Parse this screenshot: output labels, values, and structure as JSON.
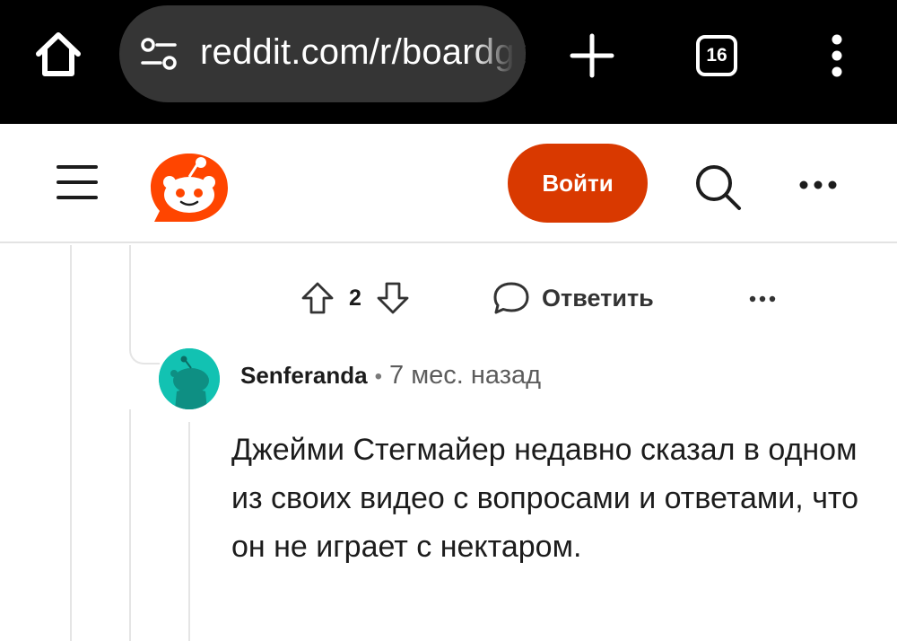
{
  "browser": {
    "url": "reddit.com/r/boardgames",
    "tab_count": "16",
    "icons": [
      "home-icon",
      "site-settings-icon",
      "plus-icon",
      "tabs-icon",
      "kebab-menu-icon"
    ],
    "colors": {
      "bar": "#000000",
      "urlbar": "#353535"
    }
  },
  "header": {
    "login_label": "Войти",
    "icons": [
      "hamburger-menu-icon",
      "reddit-logo-icon",
      "search-icon",
      "more-icon"
    ],
    "colors": {
      "brand": "#ff4500",
      "login_button": "#d93900"
    }
  },
  "comment_actions": {
    "vote_count": "2",
    "reply_label": "Ответить",
    "icons": [
      "upvote-icon",
      "downvote-icon",
      "reply-bubble-icon",
      "more-options-icon"
    ]
  },
  "reply": {
    "username": "Senferanda",
    "separator": "•",
    "timestamp": "7 мес. назад",
    "body": "Джейми Стегмайер недавно сказал в одном из своих видео с вопросами и ответами, что он не играет с нектаром.",
    "avatar_color": "#12c2b2"
  }
}
